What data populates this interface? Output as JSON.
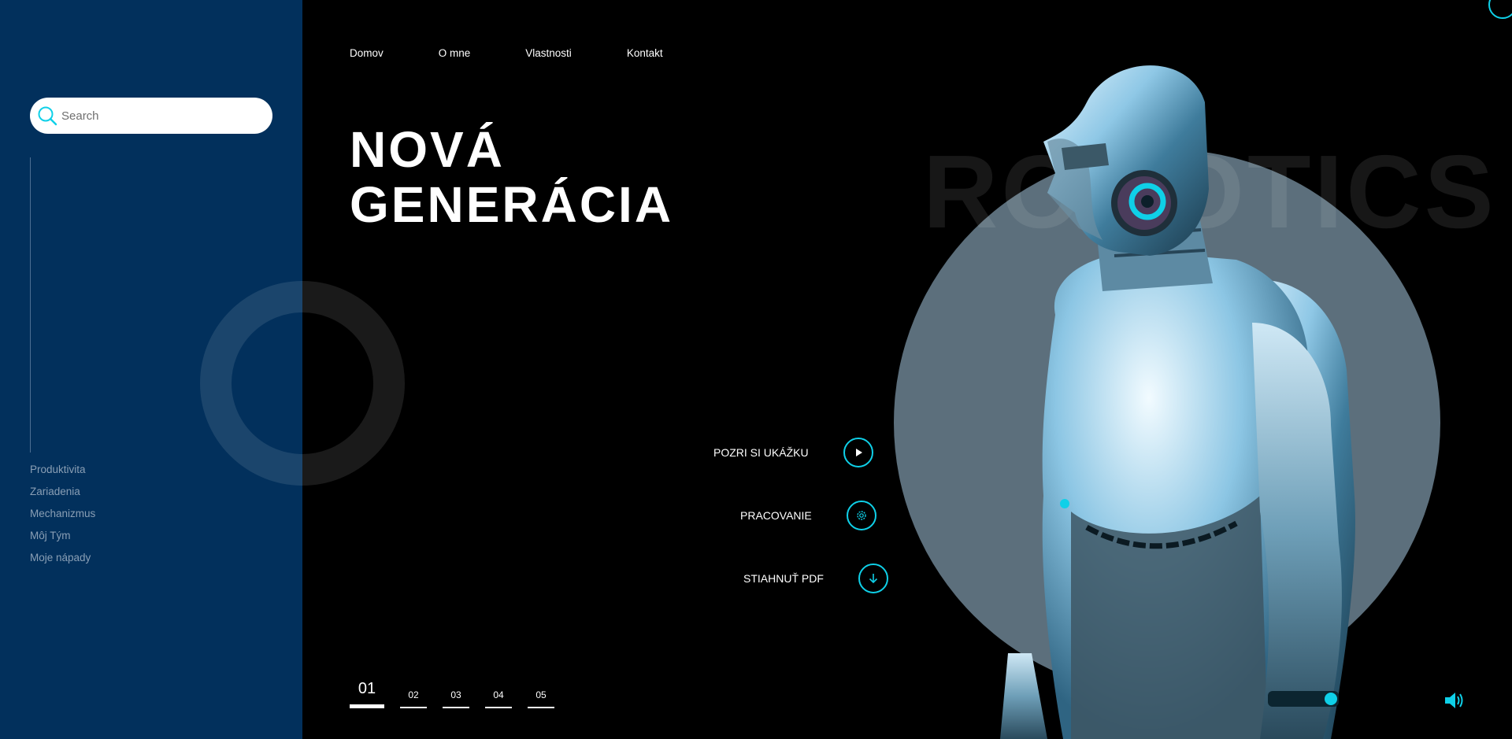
{
  "search": {
    "placeholder": "Search"
  },
  "sidebar": {
    "items": [
      {
        "label": "Produktivita"
      },
      {
        "label": "Zariadenia"
      },
      {
        "label": "Mechanizmus"
      },
      {
        "label": "Môj Tým"
      },
      {
        "label": "Moje nápady"
      }
    ]
  },
  "nav": {
    "items": [
      {
        "label": "Domov"
      },
      {
        "label": "O mne"
      },
      {
        "label": "Vlastnosti"
      },
      {
        "label": "Kontakt"
      }
    ]
  },
  "hero": {
    "line1": "NOVÁ",
    "line2": "GENERÁCIA",
    "watermark": "ROBOTICS"
  },
  "actions": [
    {
      "label": "POZRI SI UKÁŽKU",
      "icon": "play-icon"
    },
    {
      "label": "PRACOVANIE",
      "icon": "gear-icon"
    },
    {
      "label": "STIAHNUŤ PDF",
      "icon": "download-icon"
    }
  ],
  "pager": {
    "pages": [
      "01",
      "02",
      "03",
      "04",
      "05"
    ],
    "active": "01"
  },
  "colors": {
    "sidebar": "#02305c",
    "accent": "#0fd0e8",
    "background": "#000000",
    "circle": "#5c6f7c"
  }
}
